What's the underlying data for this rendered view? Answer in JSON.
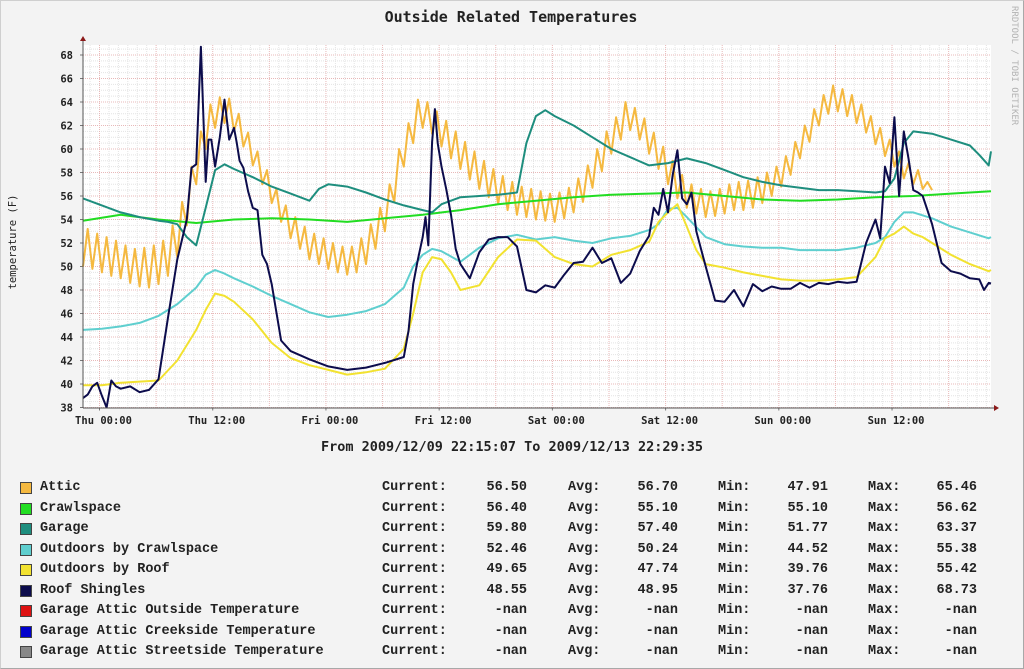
{
  "chart_data": {
    "type": "line",
    "title": "Outside Related Temperatures",
    "ylabel": "temperature (F)",
    "xlabel": "",
    "ylim": [
      38,
      69
    ],
    "yticks": [
      38,
      40,
      42,
      44,
      46,
      48,
      50,
      52,
      54,
      56,
      58,
      60,
      62,
      64,
      66,
      68
    ],
    "x_unit": "hours since 2009/12/09 22:15:07",
    "xlim": [
      0,
      96.24
    ],
    "xticks": [
      {
        "hour": 1.75,
        "label": "Thu 00:00"
      },
      {
        "hour": 13.75,
        "label": "Thu 12:00"
      },
      {
        "hour": 25.75,
        "label": "Fri 00:00"
      },
      {
        "hour": 37.75,
        "label": "Fri 12:00"
      },
      {
        "hour": 49.75,
        "label": "Sat 00:00"
      },
      {
        "hour": 61.75,
        "label": "Sat 12:00"
      },
      {
        "hour": 73.75,
        "label": "Sun 00:00"
      },
      {
        "hour": 85.75,
        "label": "Sun 12:00"
      }
    ],
    "grid": true,
    "time_range_text": "From 2009/12/09 22:15:07 To 2009/12/13 22:29:35",
    "watermark": "RRDTOOL / TOBI OETIKER",
    "series": [
      {
        "name": "Attic",
        "color": "#f5b940",
        "x": [
          0,
          0.5,
          1,
          1.5,
          2,
          2.5,
          3,
          3.5,
          4,
          4.5,
          5,
          5.5,
          6,
          6.5,
          7,
          7.5,
          8,
          8.5,
          9,
          9.5,
          10,
          10.5,
          11,
          11.5,
          12,
          12.5,
          13,
          13.5,
          14,
          14.5,
          15,
          15.5,
          16,
          16.5,
          17,
          17.5,
          18,
          18.5,
          19,
          19.5,
          20,
          20.5,
          21,
          21.5,
          22,
          22.5,
          23,
          23.5,
          24,
          24.5,
          25,
          25.5,
          26,
          26.5,
          27,
          27.5,
          28,
          28.5,
          29,
          29.5,
          30,
          30.5,
          31,
          31.5,
          32,
          32.5,
          33,
          33.5,
          34,
          34.5,
          35,
          35.5,
          36,
          36.5,
          37,
          37.5,
          38,
          38.5,
          39,
          39.5,
          40,
          40.5,
          41,
          41.5,
          42,
          42.5,
          43,
          43.5,
          44,
          44.5,
          45,
          45.5,
          46,
          46.5,
          47,
          47.5,
          48,
          48.5,
          49,
          49.5,
          50,
          50.5,
          51,
          51.5,
          52,
          52.5,
          53,
          53.5,
          54,
          54.5,
          55,
          55.5,
          56,
          56.5,
          57,
          57.5,
          58,
          58.5,
          59,
          59.5,
          60,
          60.5,
          61,
          61.5,
          62,
          62.5,
          63,
          63.5,
          64,
          64.5,
          65,
          65.5,
          66,
          66.5,
          67,
          67.5,
          68,
          68.5,
          69,
          69.5,
          70,
          70.5,
          71,
          71.5,
          72,
          72.5,
          73,
          73.5,
          74,
          74.5,
          75,
          75.5,
          76,
          76.5,
          77,
          77.5,
          78,
          78.5,
          79,
          79.5,
          80,
          80.5,
          81,
          81.5,
          82,
          82.5,
          83,
          83.5,
          84,
          84.5,
          85,
          85.5,
          86,
          86.5,
          87,
          87.5,
          88,
          88.5,
          89,
          89.5,
          90,
          90.5,
          91,
          91.5,
          92,
          92.5,
          93,
          93.5,
          94,
          94.5,
          95,
          95.5,
          96
        ],
        "values": [
          50.0,
          53.2,
          49.8,
          52.8,
          49.5,
          52.5,
          49.2,
          52.2,
          49.0,
          51.8,
          48.6,
          51.5,
          48.3,
          51.6,
          48.2,
          51.8,
          48.5,
          52.2,
          49.2,
          53.5,
          50.8,
          55.5,
          53.5,
          58.5,
          57.0,
          61.5,
          60.0,
          63.8,
          61.8,
          64.4,
          62.2,
          64.3,
          61.5,
          63.0,
          60.2,
          61.4,
          58.6,
          59.8,
          57.0,
          58.2,
          55.4,
          56.6,
          53.8,
          55.2,
          52.4,
          54.2,
          51.5,
          53.4,
          50.6,
          52.8,
          50.2,
          52.4,
          49.8,
          52.0,
          49.5,
          51.7,
          49.3,
          51.7,
          49.5,
          52.4,
          50.2,
          53.6,
          51.5,
          55.0,
          53.0,
          57.0,
          55.5,
          60.0,
          58.5,
          62.2,
          60.5,
          64.2,
          61.8,
          64.0,
          61.3,
          63.2,
          60.2,
          62.4,
          59.2,
          61.5,
          58.3,
          60.6,
          57.4,
          59.8,
          56.6,
          59.0,
          55.9,
          58.3,
          55.3,
          57.7,
          54.8,
          57.2,
          54.4,
          56.8,
          54.2,
          56.6,
          54.0,
          56.4,
          53.9,
          56.2,
          53.8,
          56.3,
          54.1,
          56.7,
          54.6,
          57.5,
          55.5,
          58.6,
          56.7,
          60.0,
          58.1,
          61.5,
          59.6,
          62.7,
          60.8,
          64.0,
          61.6,
          63.5,
          60.8,
          62.6,
          59.6,
          61.4,
          58.3,
          60.2,
          57.0,
          59.0,
          55.8,
          57.8,
          55.0,
          57.0,
          54.5,
          56.6,
          54.2,
          56.4,
          54.3,
          56.6,
          54.5,
          57.0,
          54.8,
          57.2,
          54.8,
          57.3,
          55.0,
          57.6,
          55.4,
          58.0,
          56.0,
          58.5,
          56.8,
          59.4,
          57.8,
          60.6,
          59.2,
          62.0,
          60.6,
          63.4,
          62.0,
          64.6,
          63.0,
          65.4,
          63.2,
          65.1,
          62.8,
          64.6,
          62.2,
          63.8,
          61.4,
          62.8,
          60.4,
          61.8,
          59.4,
          60.8,
          58.5,
          59.8,
          57.5,
          58.8,
          57.0,
          58.2,
          56.6,
          57.2,
          56.5
        ]
      },
      {
        "name": "Crawlspace",
        "color": "#22dd22",
        "x": [
          0,
          4,
          8,
          12,
          16,
          20,
          24,
          28,
          32,
          36,
          40,
          44,
          48,
          52,
          56,
          60,
          64,
          68,
          72,
          76,
          80,
          84,
          88,
          92,
          96.24
        ],
        "values": [
          53.9,
          54.4,
          54.0,
          53.7,
          54.0,
          54.1,
          54.0,
          53.8,
          54.1,
          54.4,
          54.8,
          55.3,
          55.6,
          55.9,
          56.1,
          56.2,
          56.3,
          56.0,
          55.7,
          55.6,
          55.7,
          55.9,
          56.0,
          56.2,
          56.4
        ]
      },
      {
        "name": "Garage",
        "color": "#1e8e7e",
        "x": [
          0,
          2,
          4,
          6,
          8,
          9,
          10,
          11,
          12,
          13,
          14,
          15,
          16,
          18,
          20,
          22,
          24,
          25,
          26,
          28,
          30,
          32,
          34,
          36,
          37,
          38,
          40,
          42,
          44,
          46,
          47,
          48,
          49,
          50,
          52,
          54,
          56,
          58,
          60,
          62,
          64,
          66,
          68,
          70,
          72,
          74,
          76,
          78,
          80,
          82,
          84,
          85,
          86,
          87,
          88,
          90,
          92,
          94,
          95,
          96,
          96.24
        ],
        "values": [
          55.8,
          55.2,
          54.6,
          54.2,
          53.9,
          53.8,
          53.6,
          52.5,
          51.8,
          55.0,
          58.2,
          58.7,
          58.3,
          57.6,
          56.8,
          56.2,
          55.6,
          56.6,
          57.0,
          56.8,
          56.3,
          55.7,
          55.2,
          54.8,
          54.6,
          55.3,
          55.9,
          56.0,
          56.1,
          56.3,
          60.5,
          62.8,
          63.3,
          62.8,
          62.0,
          61.0,
          60.0,
          59.3,
          58.6,
          58.8,
          59.2,
          58.8,
          58.2,
          57.6,
          57.2,
          56.9,
          56.7,
          56.5,
          56.5,
          56.4,
          56.3,
          56.4,
          57.5,
          60.5,
          61.5,
          61.3,
          60.8,
          60.3,
          59.5,
          58.6,
          59.8
        ]
      },
      {
        "name": "Outdoors by Crawlspace",
        "color": "#5fcfcf",
        "x": [
          0,
          2,
          4,
          6,
          8,
          10,
          12,
          13,
          14,
          15,
          16,
          18,
          20,
          22,
          24,
          26,
          28,
          30,
          32,
          34,
          35,
          36,
          37,
          38,
          40,
          42,
          44,
          46,
          48,
          50,
          52,
          54,
          56,
          58,
          60,
          61,
          62,
          63,
          64,
          66,
          68,
          70,
          72,
          74,
          76,
          78,
          80,
          82,
          84,
          85,
          86,
          87,
          88,
          90,
          92,
          94,
          96,
          96.24
        ],
        "values": [
          44.6,
          44.7,
          44.9,
          45.2,
          45.8,
          46.8,
          48.2,
          49.3,
          49.7,
          49.4,
          49.0,
          48.3,
          47.5,
          46.8,
          46.1,
          45.7,
          45.9,
          46.2,
          46.8,
          48.2,
          50.0,
          51.0,
          51.5,
          51.3,
          50.4,
          51.6,
          52.4,
          52.7,
          52.3,
          52.5,
          52.2,
          52.0,
          52.4,
          52.6,
          53.1,
          53.6,
          54.9,
          55.0,
          54.2,
          52.5,
          51.9,
          51.7,
          51.6,
          51.6,
          51.4,
          51.4,
          51.4,
          51.6,
          52.0,
          52.5,
          53.8,
          54.6,
          54.6,
          54.1,
          53.4,
          52.9,
          52.4,
          52.5
        ]
      },
      {
        "name": "Outdoors by Roof",
        "color": "#f2e230",
        "x": [
          0,
          2,
          4,
          6,
          8,
          10,
          12,
          13,
          14,
          15,
          16,
          18,
          20,
          22,
          24,
          26,
          28,
          30,
          32,
          34,
          35,
          36,
          37,
          38,
          39,
          40,
          42,
          44,
          46,
          48,
          50,
          52,
          54,
          56,
          58,
          60,
          61,
          62,
          63,
          64,
          65,
          66,
          68,
          70,
          72,
          74,
          76,
          78,
          80,
          82,
          84,
          85,
          86,
          87,
          88,
          89,
          90,
          92,
          94,
          96,
          96.24
        ],
        "values": [
          39.9,
          39.9,
          40.1,
          40.2,
          40.3,
          42.0,
          44.6,
          46.3,
          47.7,
          47.5,
          47.0,
          45.5,
          43.5,
          42.2,
          41.6,
          41.2,
          40.8,
          41.0,
          41.3,
          43.0,
          46.0,
          49.5,
          50.8,
          50.6,
          49.5,
          48.0,
          48.4,
          50.8,
          52.3,
          52.2,
          50.8,
          50.2,
          50.0,
          51.0,
          51.4,
          52.1,
          53.8,
          54.6,
          55.3,
          53.4,
          51.4,
          50.2,
          49.9,
          49.5,
          49.2,
          48.9,
          48.8,
          48.8,
          48.9,
          49.1,
          50.8,
          52.4,
          52.8,
          53.4,
          52.8,
          52.5,
          52.0,
          51.0,
          50.2,
          49.6,
          49.7
        ]
      },
      {
        "name": "Roof Shingles",
        "color": "#0c0c4c",
        "x": [
          0,
          0.5,
          1,
          1.5,
          2,
          2.5,
          3,
          3.5,
          4,
          5,
          6,
          7,
          8,
          9,
          10,
          11,
          11.5,
          12,
          12.5,
          13,
          13.3,
          13.6,
          14,
          14.5,
          15,
          15.5,
          16,
          16.3,
          16.6,
          17,
          17.5,
          18,
          18.5,
          19,
          19.5,
          20,
          21,
          22,
          24,
          26,
          28,
          30,
          32,
          34,
          34.5,
          35,
          35.5,
          36,
          36.3,
          36.6,
          37,
          37.3,
          37.6,
          38,
          38.5,
          39,
          39.5,
          40,
          41,
          42,
          43,
          44,
          45,
          46,
          47,
          48,
          49,
          50,
          51,
          52,
          53,
          54,
          55,
          56,
          57,
          58,
          59,
          60,
          60.5,
          61,
          61.5,
          62,
          62.5,
          63,
          63.5,
          64,
          64.5,
          65,
          66,
          67,
          68,
          69,
          70,
          71,
          72,
          73,
          74,
          75,
          76,
          77,
          78,
          79,
          80,
          81,
          82,
          83,
          84,
          84.5,
          85,
          85.5,
          86,
          86.5,
          87,
          87.5,
          88,
          88.5,
          89,
          90,
          91,
          92,
          93,
          94,
          95,
          95.5,
          96,
          96.24
        ],
        "values": [
          38.8,
          39.1,
          39.8,
          40.1,
          39.0,
          37.8,
          40.3,
          39.8,
          39.6,
          39.8,
          39.3,
          39.5,
          40.4,
          45.6,
          50.6,
          54.0,
          58.4,
          58.7,
          68.7,
          57.2,
          60.8,
          60.8,
          58.5,
          61.0,
          64.2,
          60.8,
          61.8,
          60.5,
          59.0,
          58.4,
          56.4,
          55.0,
          54.8,
          51.0,
          50.2,
          48.5,
          43.7,
          42.8,
          42.1,
          41.5,
          41.2,
          41.4,
          41.8,
          42.3,
          44.5,
          48.5,
          50.6,
          52.5,
          54.2,
          51.8,
          60.6,
          63.4,
          60.5,
          58.5,
          56.6,
          54.4,
          51.5,
          50.2,
          49.0,
          51.2,
          52.3,
          52.5,
          52.5,
          51.7,
          48.0,
          47.8,
          48.4,
          48.2,
          49.3,
          50.3,
          50.4,
          51.6,
          50.3,
          50.7,
          48.6,
          49.4,
          51.3,
          52.6,
          55.0,
          54.4,
          56.6,
          54.6,
          57.8,
          59.9,
          55.8,
          55.3,
          56.3,
          53.0,
          50.0,
          47.1,
          47.0,
          48.0,
          46.6,
          48.5,
          47.9,
          48.3,
          48.1,
          48.1,
          48.6,
          48.2,
          48.6,
          48.5,
          48.7,
          48.6,
          48.7,
          52.0,
          54.0,
          52.4,
          58.5,
          57.1,
          62.7,
          56.0,
          61.5,
          59.2,
          56.5,
          56.3,
          56.0,
          53.6,
          50.3,
          49.6,
          49.4,
          49.0,
          48.9,
          48.0,
          48.6,
          48.55
        ]
      },
      {
        "name": "Garage Attic Outside Temperature",
        "color": "#dd1111",
        "x": [],
        "values": []
      },
      {
        "name": "Garage Attic Creekside Temperature",
        "color": "#0000cc",
        "x": [],
        "values": []
      },
      {
        "name": "Garage Attic Streetside Temperature",
        "color": "#888888",
        "x": [],
        "values": []
      }
    ]
  },
  "legend": {
    "labels": {
      "current": "Current:",
      "avg": "Avg:",
      "min": "Min:",
      "max": "Max:"
    },
    "rows": [
      {
        "name": "Attic",
        "color": "#f5b940",
        "current": "56.50",
        "avg": "56.70",
        "min": "47.91",
        "max": "65.46"
      },
      {
        "name": "Crawlspace",
        "color": "#22dd22",
        "current": "56.40",
        "avg": "55.10",
        "min": "55.10",
        "max": "56.62"
      },
      {
        "name": "Garage",
        "color": "#1e8e7e",
        "current": "59.80",
        "avg": "57.40",
        "min": "51.77",
        "max": "63.37"
      },
      {
        "name": "Outdoors by Crawlspace",
        "color": "#5fcfcf",
        "current": "52.46",
        "avg": "50.24",
        "min": "44.52",
        "max": "55.38"
      },
      {
        "name": "Outdoors by Roof",
        "color": "#f2e230",
        "current": "49.65",
        "avg": "47.74",
        "min": "39.76",
        "max": "55.42"
      },
      {
        "name": "Roof Shingles",
        "color": "#0c0c4c",
        "current": "48.55",
        "avg": "48.95",
        "min": "37.76",
        "max": "68.73"
      },
      {
        "name": "Garage Attic Outside Temperature",
        "color": "#dd1111",
        "current": "-nan",
        "avg": "-nan",
        "min": "-nan",
        "max": "-nan"
      },
      {
        "name": "Garage Attic Creekside Temperature",
        "color": "#0000cc",
        "current": "-nan",
        "avg": "-nan",
        "min": "-nan",
        "max": "-nan"
      },
      {
        "name": "Garage Attic Streetside Temperature",
        "color": "#888888",
        "current": "-nan",
        "avg": "-nan",
        "min": "-nan",
        "max": "-nan"
      }
    ]
  }
}
